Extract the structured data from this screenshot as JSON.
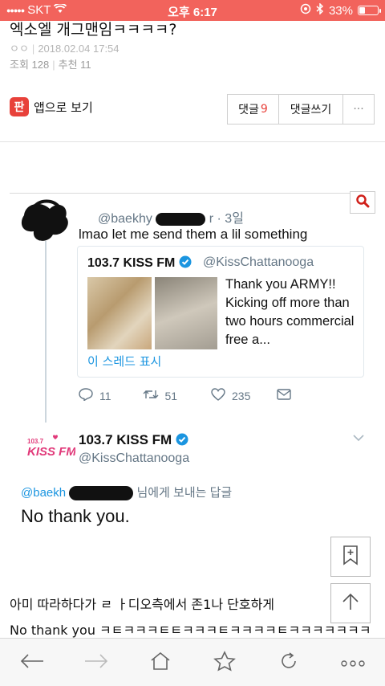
{
  "statusbar": {
    "carrier": "SKT",
    "time": "오후 6:17",
    "battery": "33%"
  },
  "post": {
    "title": "엑소엘 개그맨임ㅋㅋㅋㅋ?",
    "author": "ㅇㅇ",
    "date": "2018.02.04 17:54",
    "views_label": "조회 128",
    "recommend_label": "추천 11"
  },
  "appbar": {
    "logo_text": "판",
    "open_app_label": "앱으로 보기",
    "comments_label": "댓글",
    "comments_count": "9",
    "write_comment_label": "댓글쓰기",
    "more_label": "···"
  },
  "tweet": {
    "handle_visible": "@baekhy",
    "handle_tail": "r · 3일",
    "reply_text": "lmao let me send them a lil something",
    "quote": {
      "name": "103.7 KISS FM",
      "handle": "@KissChattanooga",
      "text": "Thank you ARMY!! Kicking off more than two hours commercial free a...",
      "thread_link": "이 스레드 표시"
    },
    "stats": {
      "replies": "11",
      "retweets": "51",
      "likes": "235"
    },
    "account": {
      "name": "103.7 KISS FM",
      "handle": "@KissChattanooga",
      "logo_text": "KISS FM"
    },
    "replying_prefix": "@baekh",
    "replying_suffix": "님에게 보내는 답글",
    "main_text": "No thank you."
  },
  "body": {
    "line1": "아미 따라하다가 ㄹ ㅏ디오측에서 존1나 단호하게",
    "line2": "No thank you ㅋㅌㅋㅋㅋㅌㅌㅋㅋㅋㅌㅋㅋㅋㅋㅌㅋㅋㅋㅋㅋㅋㅋ"
  },
  "colors": {
    "accent": "#e8413a",
    "statusbar": "#f2635c",
    "twitter_blue": "#1b95e0"
  },
  "icons": [
    "wifi-icon",
    "location-icon",
    "bluetooth-icon",
    "battery-icon",
    "search-icon",
    "verified-icon",
    "reply-icon",
    "retweet-icon",
    "like-icon",
    "dm-icon",
    "bookmark-icon",
    "scroll-top-icon",
    "back-icon",
    "forward-icon",
    "home-icon",
    "star-icon",
    "reload-icon",
    "more-icon"
  ]
}
